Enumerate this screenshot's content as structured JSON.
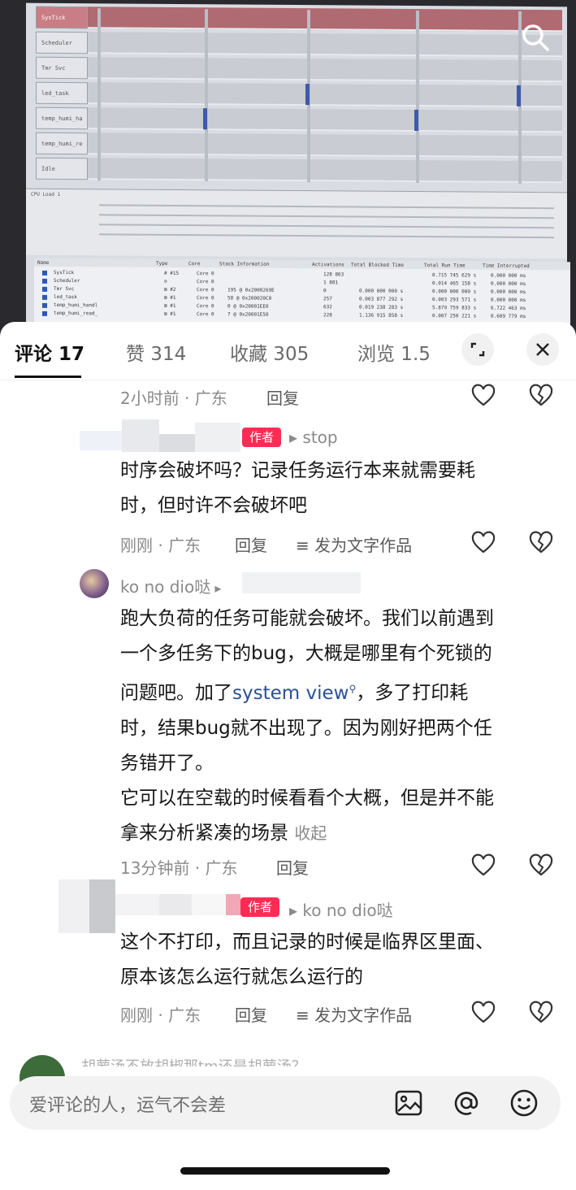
{
  "photo": {
    "rows": [
      "SysTick",
      "Scheduler",
      "Tmr Svc",
      "led_task",
      "temp_humi_ha",
      "temp_humi_re",
      "Idle"
    ],
    "cpu_load_label": "CPU Load 1",
    "table_header": [
      "Name",
      "Type",
      "Core",
      "Stack Information",
      "Activations",
      "Total Blocked Time",
      "Total Run Time",
      "Time Interrupted"
    ],
    "table_rows": [
      [
        "SysTick",
        "# #15",
        "Core 0",
        "",
        "128 863",
        "",
        "0.715 745 629 s",
        "0.000 000 ms"
      ],
      [
        "Scheduler",
        "⊘",
        "Core 0",
        "",
        "1 881",
        "",
        "0.014 465 158 s",
        "0.000 000 ms"
      ],
      [
        "Tmr Svc",
        "⊠ #2",
        "Core 0",
        "195 @ 0x2000269E",
        "0",
        "0.000 000 000 s",
        "0.000 000 000 s",
        "0.000 000 ms"
      ],
      [
        "led_task",
        "⊠ #1",
        "Core 0",
        "58 @ 0x200020C0",
        "257",
        "0.003 877 292 s",
        "0.003 293 571 s",
        "0.000 000 ms"
      ],
      [
        "temp_humi_handl",
        "⊠ #1",
        "Core 0",
        "0 @ 0x20001EE0",
        "632",
        "0.019 238 283 s",
        "5.879 759 833 s",
        "6.722 463 ms"
      ],
      [
        "temp_humi_read_",
        "⊠ #1",
        "Core 0",
        "7 @ 0x20001E50",
        "228",
        "1.136 915 858 s",
        "0.007 250 221 s",
        "0.609 779 ms"
      ]
    ]
  },
  "tabs": {
    "comments": "评论 17",
    "likes": "赞 314",
    "favorites": "收藏 305",
    "views": "浏览 1.5"
  },
  "comments": [
    {
      "meta": "2小时前 · 广东",
      "reply": "回复"
    },
    {
      "author_badge": "作者",
      "reply_to": "stop",
      "lines": [
        "时序会破坏吗？记录任务运行本来就需要耗",
        "时，但时许不会破坏吧"
      ],
      "meta": "刚刚 · 广东",
      "reply": "回复",
      "publish": "发为文字作品"
    },
    {
      "username": "ko no dio哒",
      "lines_a": [
        "跑大负荷的任务可能就会破坏。我们以前遇到",
        "一个多任务下的bug，大概是哪里有个死锁的"
      ],
      "line_link_pre": "问题吧。加了",
      "link": "system view",
      "line_link_post": "，多了打印耗",
      "lines_b": [
        "时，结果bug就不出现了。因为刚好把两个任",
        "务错开了。",
        "它可以在空载的时候看看个大概，但是并不能"
      ],
      "last_line": "拿来分析紧凑的场景",
      "collapse": "收起",
      "meta": "13分钟前 · 广东",
      "reply": "回复"
    },
    {
      "author_badge": "作者",
      "reply_to": "ko no dio哒",
      "lines": [
        "这个不打印，而且记录的时候是临界区里面、",
        "原本该怎么运行就怎么运行的"
      ],
      "meta": "刚刚 · 广东",
      "reply": "回复",
      "publish": "发为文字作品"
    }
  ],
  "peek_text": "胡萝汤不放胡椒那tm还是胡萝汤？",
  "input": {
    "placeholder": "爱评论的人，运气不会差"
  },
  "colors": {
    "author_badge": "#fe2c55",
    "link": "#2a5196",
    "tab_active": "#111111"
  }
}
